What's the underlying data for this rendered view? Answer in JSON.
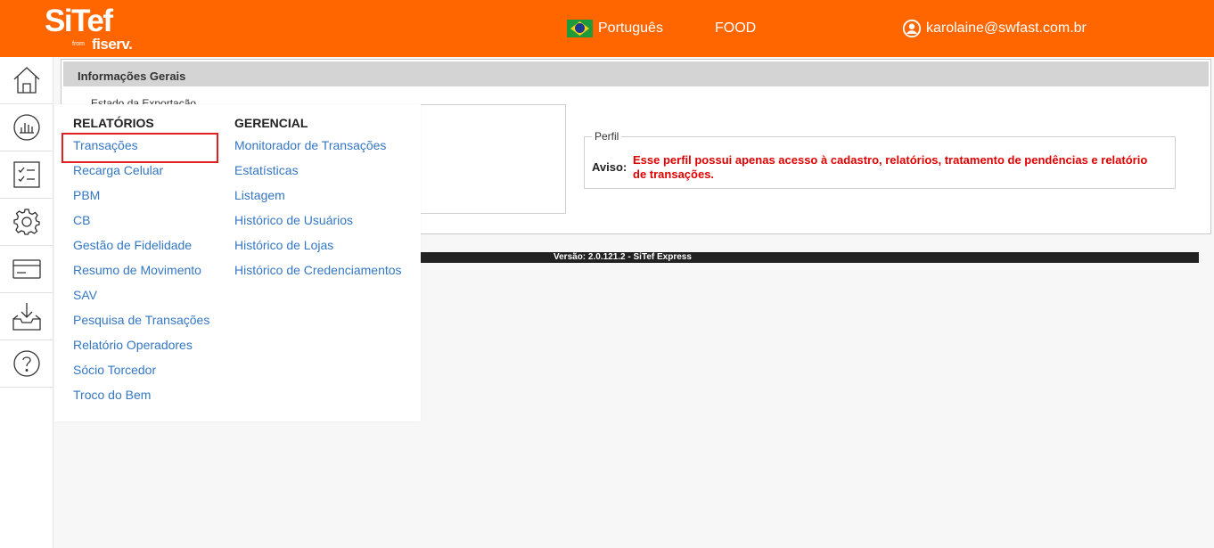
{
  "header": {
    "logo": {
      "main": "SiTef",
      "from": "from",
      "brand": "fiserv."
    },
    "language": "Português",
    "business": "FOOD",
    "user_email": "karolaine@swfast.com.br",
    "flag_icon": "brazil-flag-icon",
    "user_icon": "user-circle-icon",
    "accent_color": "#ff6600"
  },
  "sidebar": {
    "items": [
      {
        "icon": "home-icon"
      },
      {
        "icon": "reports-chart-icon"
      },
      {
        "icon": "checklist-icon"
      },
      {
        "icon": "gear-icon"
      },
      {
        "icon": "card-icon"
      },
      {
        "icon": "inbox-download-icon"
      },
      {
        "icon": "help-icon"
      }
    ]
  },
  "panel": {
    "title": "Informações Gerais",
    "export_legend": "Estado da Exportação",
    "perfil_legend": "Perfil",
    "aviso_label": "Aviso:",
    "aviso_text": "Esse perfil possui apenas acesso à cadastro, relatórios, tratamento de pendências e relatório de transações."
  },
  "footer": {
    "version": "Versão: 2.0.121.2 - SiTef Express"
  },
  "menu": {
    "relatorios": {
      "title": "RELATÓRIOS",
      "items": [
        "Transações",
        "Recarga Celular",
        "PBM",
        "CB",
        "Gestão de Fidelidade",
        "Resumo de Movimento",
        "SAV",
        "Pesquisa de Transações",
        "Relatório Operadores",
        "Sócio Torcedor",
        "Troco do Bem"
      ]
    },
    "gerencial": {
      "title": "GERENCIAL",
      "items": [
        "Monitorador de Transações",
        "Estatísticas",
        "Listagem",
        "Histórico de Usuários",
        "Histórico de Lojas",
        "Histórico de Credenciamentos"
      ]
    }
  }
}
